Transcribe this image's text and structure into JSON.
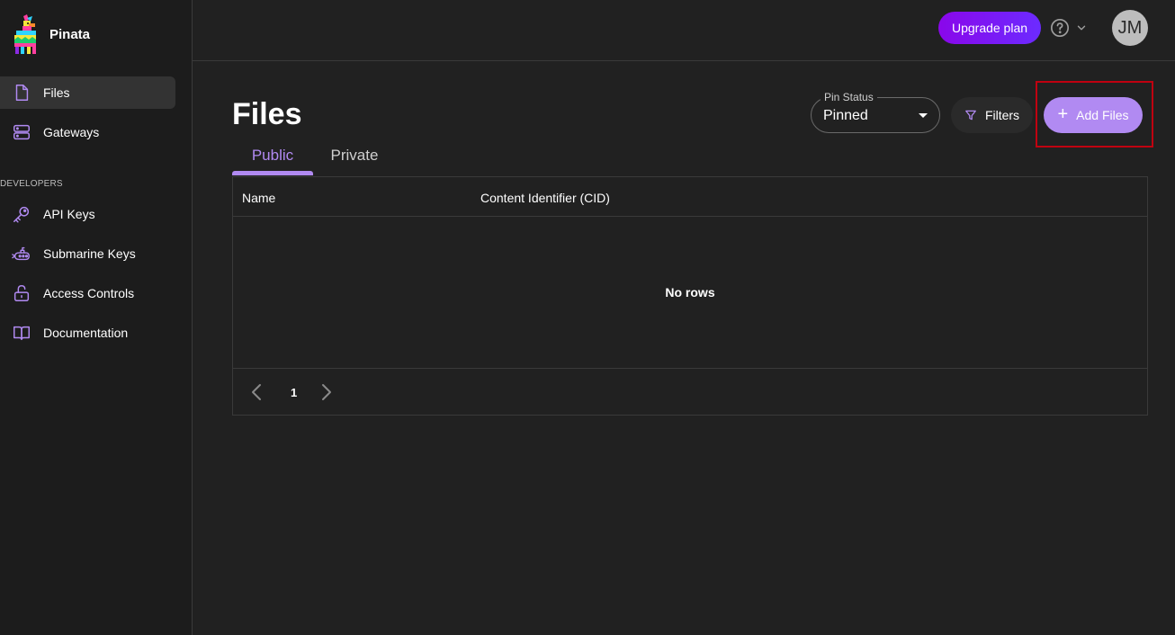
{
  "brand": {
    "name": "Pinata",
    "logo_icon": "pinata-llama-logo"
  },
  "sidebar": {
    "items": [
      {
        "label": "Files",
        "icon": "file-icon",
        "active": true
      },
      {
        "label": "Gateways",
        "icon": "server-icon",
        "active": false
      }
    ],
    "section_label": "DEVELOPERS",
    "dev_items": [
      {
        "label": "API Keys",
        "icon": "key-icon"
      },
      {
        "label": "Submarine Keys",
        "icon": "submarine-icon"
      },
      {
        "label": "Access Controls",
        "icon": "unlock-icon"
      },
      {
        "label": "Documentation",
        "icon": "book-icon"
      }
    ]
  },
  "header": {
    "upgrade_label": "Upgrade plan",
    "help_icon": "help-circle-icon",
    "avatar_initials": "JM"
  },
  "main": {
    "title": "Files",
    "pin_status": {
      "label": "Pin Status",
      "value": "Pinned"
    },
    "filters_label": "Filters",
    "add_files_label": "Add Files",
    "tabs": [
      {
        "label": "Public",
        "active": true
      },
      {
        "label": "Private",
        "active": false
      }
    ],
    "table": {
      "columns": [
        "Name",
        "Content Identifier (CID)"
      ],
      "empty_text": "No rows"
    },
    "pagination": {
      "current_page": "1"
    }
  },
  "colors": {
    "accent": "#b18af2",
    "upgrade_gradient_start": "#8a07ea",
    "upgrade_gradient_end": "#6c2bff",
    "background": "#212121",
    "sidebar_background": "#1c1c1c",
    "highlight": "#c00010"
  }
}
